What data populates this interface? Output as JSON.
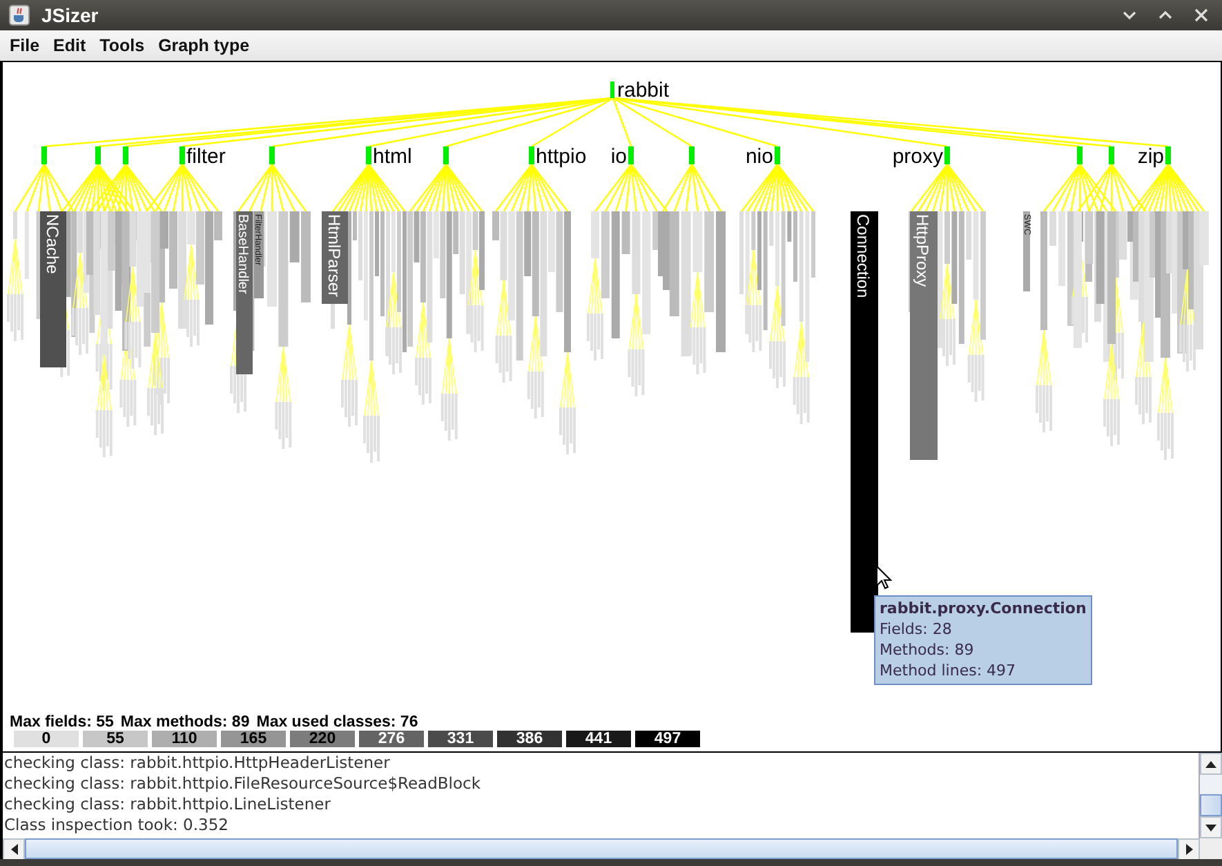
{
  "window": {
    "title": "JSizer"
  },
  "menu": [
    "File",
    "Edit",
    "Tools",
    "Graph type"
  ],
  "graph": {
    "root": "rabbit",
    "packages": [
      {
        "kind": "unlabeled"
      },
      {
        "kind": "unlabeled"
      },
      {
        "kind": "unlabeled"
      },
      {
        "kind": "labeled",
        "label": "filter"
      },
      {
        "kind": "unlabeled"
      },
      {
        "kind": "labeled",
        "label": "html"
      },
      {
        "kind": "unlabeled"
      },
      {
        "kind": "labeled",
        "label": "httpio"
      },
      {
        "kind": "labeled",
        "label": "io"
      },
      {
        "kind": "unlabeled"
      },
      {
        "kind": "labeled",
        "label": "nio"
      },
      {
        "kind": "labeled",
        "label": "proxy"
      },
      {
        "kind": "unlabeled"
      },
      {
        "kind": "unlabeled"
      },
      {
        "kind": "labeled",
        "label": "zip"
      }
    ],
    "classes": [
      {
        "label": "NCache"
      },
      {
        "label": "BaseHandler"
      },
      {
        "label": "FilterHandler"
      },
      {
        "label": "HtmlParser"
      },
      {
        "label": "Connection"
      },
      {
        "label": "HttpProxy"
      },
      {
        "label": "SWC"
      }
    ],
    "tooltip": {
      "title": "rabbit.proxy.Connection",
      "lines": [
        "Fields: 28",
        "Methods: 89",
        "Method lines: 497"
      ]
    }
  },
  "stats": [
    "Max fields: 55",
    "Max methods: 89",
    "Max used classes: 76"
  ],
  "legend": [
    "0",
    "55",
    "110",
    "165",
    "220",
    "276",
    "331",
    "386",
    "441",
    "497"
  ],
  "log": [
    "checking class: rabbit.httpio.HttpHeaderListener",
    "checking class: rabbit.httpio.FileResourceSource$ReadBlock",
    "checking class: rabbit.httpio.LineListener",
    "Class inspection took: 0.352"
  ]
}
